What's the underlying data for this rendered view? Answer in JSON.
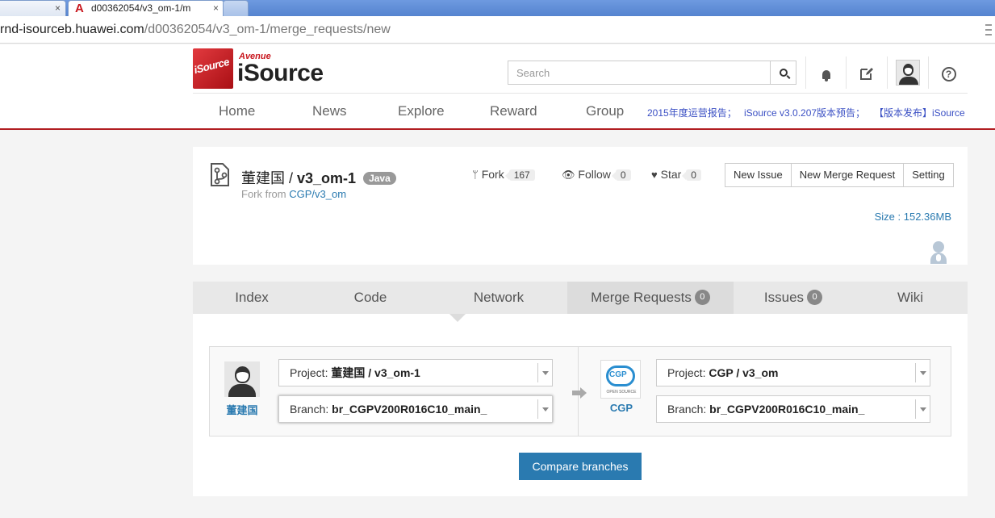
{
  "browser": {
    "prev_tab_close": "×",
    "active_tab_title": "d00362054/v3_om-1/m",
    "active_tab_close": "×",
    "url_host": "rnd-isourceb.huawei.com",
    "url_path": "/d00362054/v3_om-1/merge_requests/new"
  },
  "header": {
    "logo_box_text": "iSource",
    "logo_avenue": "Avenue",
    "logo_name": "iSource",
    "search_placeholder": "Search",
    "nav": [
      "Home",
      "News",
      "Explore",
      "Reward",
      "Group"
    ],
    "announcements": [
      "2015年度运营报告；",
      "iSource v3.0.207版本预告；",
      "【版本发布】iSource"
    ]
  },
  "project": {
    "owner": "董建国",
    "separator": " / ",
    "name": "v3_om-1",
    "language": "Java",
    "fork_from_label": "Fork from",
    "fork_from_link": "CGP/v3_om",
    "fork_label": "Fork",
    "fork_count": "167",
    "follow_label": "Follow",
    "follow_count": "0",
    "star_label": "Star",
    "star_count": "0",
    "actions": [
      "New Issue",
      "New Merge Request",
      "Setting"
    ],
    "size": "Size : 152.36MB"
  },
  "tabs": {
    "index": "Index",
    "code": "Code",
    "network": "Network",
    "merge_requests": "Merge Requests",
    "merge_requests_count": "0",
    "issues": "Issues",
    "issues_count": "0",
    "wiki": "Wiki"
  },
  "merge": {
    "source_owner": "董建国",
    "source_project_label": "Project:",
    "source_project_value": "董建国 / v3_om-1",
    "source_branch_label": "Branch:",
    "source_branch_value": "br_CGPV200R016C10_main_",
    "target_logo_text": "CGP",
    "target_logo_sub": "OPEN SOURCE",
    "target_owner": "CGP",
    "target_project_label": "Project:",
    "target_project_value": "CGP / v3_om",
    "target_branch_label": "Branch:",
    "target_branch_value": "br_CGPV200R016C10_main_",
    "compare_button": "Compare branches"
  },
  "colors": {
    "brand_red": "#b11e22",
    "link_blue": "#2a7ab0",
    "announcement_blue": "#3b50c4"
  }
}
